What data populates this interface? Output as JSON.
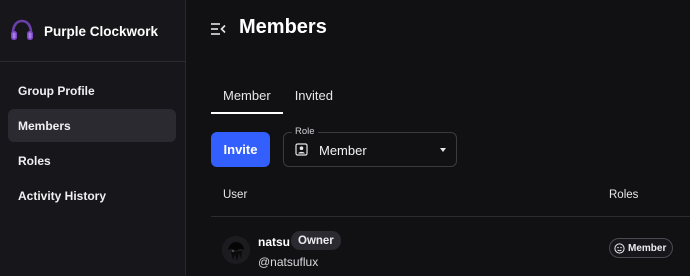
{
  "sidebar": {
    "brand": {
      "name": "Purple Clockwork",
      "icon": "purple-headphones-logo"
    },
    "items": [
      {
        "label": "Group Profile",
        "active": false
      },
      {
        "label": "Members",
        "active": true
      },
      {
        "label": "Roles",
        "active": false
      },
      {
        "label": "Activity History",
        "active": false
      }
    ]
  },
  "header": {
    "title": "Members",
    "collapse_icon": "menu-collapse-icon"
  },
  "tabs": [
    {
      "label": "Member",
      "active": true
    },
    {
      "label": "Invited",
      "active": false
    }
  ],
  "toolbar": {
    "invite_label": "Invite",
    "role_filter": {
      "label": "Role",
      "value": "Member",
      "icon": "contact-card-icon"
    }
  },
  "table": {
    "columns": [
      "User",
      "Roles"
    ],
    "rows": [
      {
        "name": "natsu",
        "badge": "Owner",
        "handle": "@natsuflux",
        "role": "Member",
        "role_icon": "face-icon"
      }
    ]
  },
  "colors": {
    "accent": "#335fff",
    "background": "#111114",
    "sidebar": "#17171b"
  }
}
